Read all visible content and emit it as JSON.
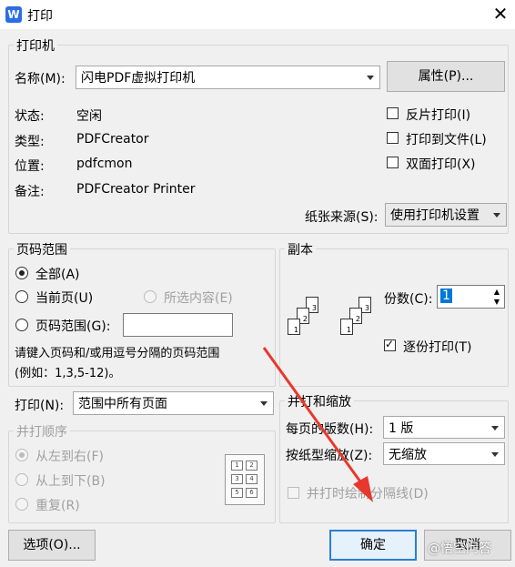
{
  "window": {
    "title": "打印",
    "app_icon_letter": "W"
  },
  "printer": {
    "group_title": "打印机",
    "name_label": "名称(M):",
    "name_value": "闪电PDF虚拟打印机",
    "properties_button": "属性(P)...",
    "status_label": "状态:",
    "status_value": "空闲",
    "type_label": "类型:",
    "type_value": "PDFCreator",
    "location_label": "位置:",
    "location_value": "pdfcmon",
    "comment_label": "备注:",
    "comment_value": "PDFCreator Printer",
    "reverse_print": {
      "label": "反片打印(I)",
      "checked": false
    },
    "print_to_file": {
      "label": "打印到文件(L)",
      "checked": false
    },
    "duplex": {
      "label": "双面打印(X)",
      "checked": false
    },
    "paper_source_label": "纸张来源(S):",
    "paper_source_value": "使用打印机设置"
  },
  "page_range": {
    "group_title": "页码范围",
    "all": {
      "label": "全部(A)",
      "selected": true
    },
    "current": {
      "label": "当前页(U)",
      "selected": false
    },
    "selection": {
      "label": "所选内容(E)",
      "selected": false
    },
    "pages": {
      "label": "页码范围(G):",
      "selected": false,
      "value": ""
    },
    "hint": "请键入页码和/或用逗号分隔的页码范围",
    "example": "(例如：1,3,5-12)。"
  },
  "print_what": {
    "label": "打印(N):",
    "value": "范围中所有页面"
  },
  "collate_order": {
    "group_title": "并打顺序",
    "left_to_right": "从左到右(F)",
    "top_to_bottom": "从上到下(B)",
    "repeat": "重复(R)",
    "preview_cells": [
      "1",
      "2",
      "3",
      "4",
      "5",
      "6"
    ]
  },
  "copies": {
    "group_title": "副本",
    "count_label": "份数(C):",
    "count_value": "1",
    "collate": {
      "label": "逐份打印(T)",
      "checked": true
    },
    "icon_pages": [
      "1",
      "2",
      "3"
    ]
  },
  "scaling": {
    "group_title": "并打和缩放",
    "pages_per_sheet_label": "每页的版数(H):",
    "pages_per_sheet_value": "1 版",
    "scale_to_paper_label": "按纸型缩放(Z):",
    "scale_to_paper_value": "无缩放",
    "draw_borders": {
      "label": "并打时绘制分隔线(D)",
      "checked": false
    }
  },
  "footer": {
    "options_button": "选项(O)...",
    "ok_button": "确定",
    "cancel_button": "取消"
  },
  "overlay": {
    "watermark": "@悟空问答",
    "arrow_color": "#e8382d"
  }
}
